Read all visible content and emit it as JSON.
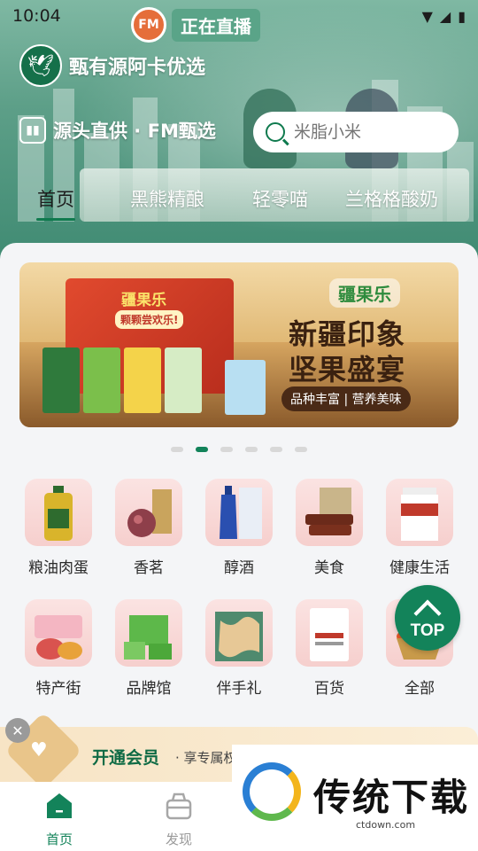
{
  "status_bar": {
    "time": "10:04"
  },
  "live": {
    "fm": "FM",
    "label": "正在直播"
  },
  "brand": {
    "name": "甄有源阿卡优选"
  },
  "slogan": {
    "text": "源头直供 · FM甄选"
  },
  "search": {
    "placeholder": "米脂小米"
  },
  "tabs": [
    {
      "label": "首页",
      "active": true
    },
    {
      "label": "黑熊精酿",
      "active": false
    },
    {
      "label": "轻零喵",
      "active": false
    },
    {
      "label": "兰格格酸奶",
      "active": false
    }
  ],
  "banner": {
    "box_brand": "疆果乐",
    "box_sub": "颗颗尝欢乐!",
    "logo": "疆果乐",
    "title_line1": "新疆印象",
    "title_line2": "坚果盛宴",
    "tagline": "品种丰富 | 营养美味"
  },
  "carousel": {
    "count": 6,
    "active_index": 1
  },
  "categories": [
    {
      "label": "粮油肉蛋",
      "icon": "oil-bottle-icon"
    },
    {
      "label": "香茗",
      "icon": "tea-icon"
    },
    {
      "label": "醇酒",
      "icon": "liquor-icon"
    },
    {
      "label": "美食",
      "icon": "food-icon"
    },
    {
      "label": "健康生活",
      "icon": "health-icon"
    },
    {
      "label": "特产街",
      "icon": "specialty-icon"
    },
    {
      "label": "品牌馆",
      "icon": "brand-icon"
    },
    {
      "label": "伴手礼",
      "icon": "gift-icon"
    },
    {
      "label": "百货",
      "icon": "goods-icon"
    },
    {
      "label": "全部",
      "icon": "all-icon"
    }
  ],
  "top_button": {
    "label": "TOP"
  },
  "member": {
    "title": "开通会员",
    "subtitle": "· 享专属权"
  },
  "tabbar": [
    {
      "label": "首页",
      "active": true
    },
    {
      "label": "发现",
      "active": false
    }
  ],
  "watermark": {
    "text": "传统下载",
    "url": "ctdown.com"
  },
  "colors": {
    "primary": "#13835a",
    "accent_text": "#0f6b45"
  }
}
